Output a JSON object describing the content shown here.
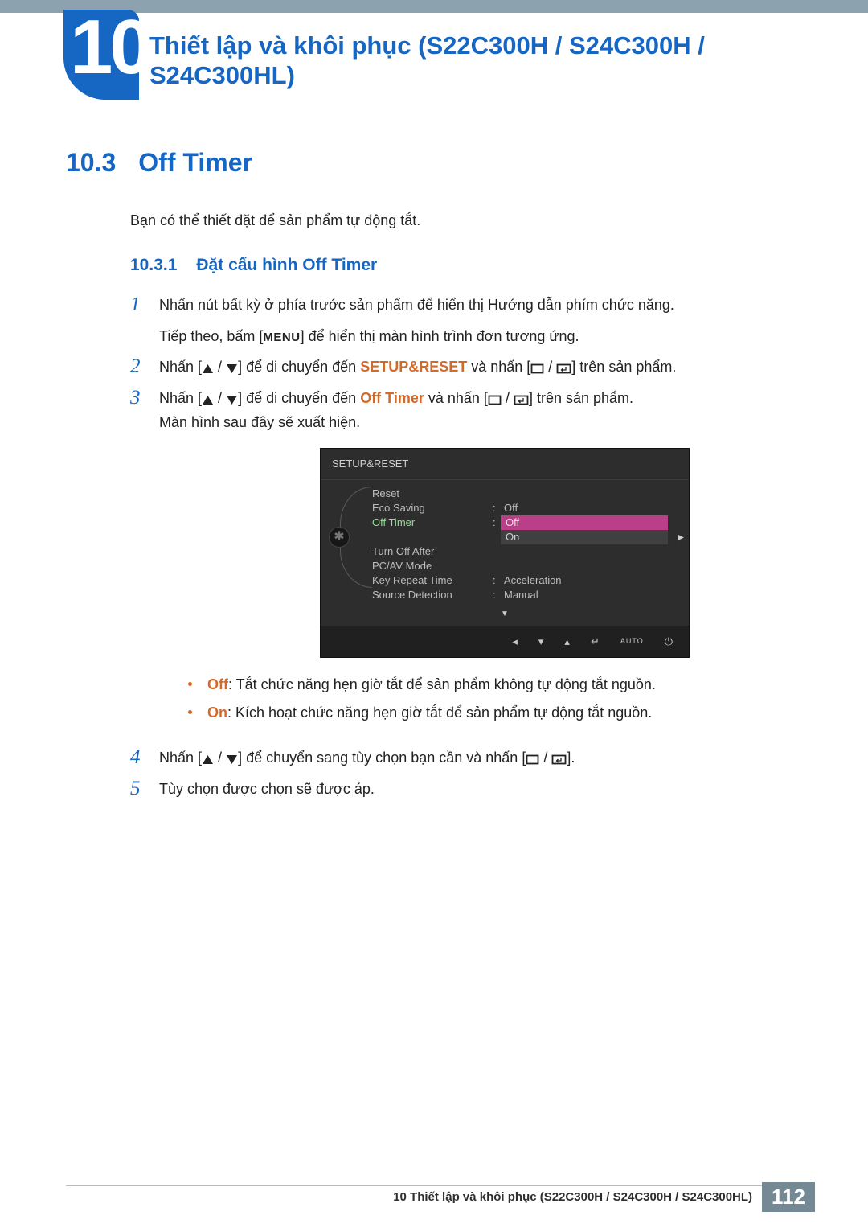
{
  "chapter": {
    "num": "10",
    "title": "Thiết lập và khôi phục (S22C300H / S24C300H / S24C300HL)"
  },
  "section": {
    "num": "10.3",
    "title": "Off Timer",
    "intro": "Bạn có thể thiết đặt để sản phẩm tự động tắt."
  },
  "subsection": {
    "num": "10.3.1",
    "title": "Đặt cấu hình Off Timer"
  },
  "steps": {
    "s1": {
      "num": "1",
      "a": "Nhấn nút bất kỳ ở phía trước sản phẩm để hiển thị Hướng dẫn phím chức năng.",
      "b_pre": "Tiếp theo, bấm [",
      "menu": "MENU",
      "b_post": "] để hiển thị màn hình trình đơn tương ứng."
    },
    "s2": {
      "num": "2",
      "a_pre": "Nhấn [",
      "a_mid": "] để di chuyển đến ",
      "kw": "SETUP&RESET",
      "a_mid2": " và nhấn [",
      "a_post": "] trên sản phẩm."
    },
    "s3": {
      "num": "3",
      "a_pre": "Nhấn [",
      "a_mid": "] để di chuyển đến ",
      "kw": "Off Timer",
      "a_mid2": " và nhấn [",
      "a_post": "] trên sản phẩm.",
      "b": "Màn hình sau đây sẽ xuất hiện.",
      "bullet_off_label": "Off",
      "bullet_off_text": ": Tắt chức năng hẹn giờ tắt để sản phẩm không tự động tắt nguồn.",
      "bullet_on_label": "On",
      "bullet_on_text": ": Kích hoạt chức năng hẹn giờ tắt để sản phẩm tự động tắt nguồn."
    },
    "s4": {
      "num": "4",
      "a_pre": "Nhấn [",
      "a_mid": "] để chuyển sang tùy chọn bạn cần và nhấn [",
      "a_post": "]."
    },
    "s5": {
      "num": "5",
      "a": "Tùy chọn được chọn sẽ được áp."
    }
  },
  "osd": {
    "title": "SETUP&RESET",
    "rows": {
      "reset": "Reset",
      "eco": "Eco Saving",
      "eco_val": "Off",
      "off_timer": "Off Timer",
      "off_timer_val": "Off",
      "off_timer_sub": "On",
      "turn_off_after": "Turn Off After",
      "pcav": "PC/AV Mode",
      "krt": "Key Repeat Time",
      "krt_val": "Acceleration",
      "src": "Source Detection",
      "src_val": "Manual"
    },
    "foot_auto": "AUTO"
  },
  "footer": {
    "text": "10 Thiết lập và khôi phục (S22C300H / S24C300H / S24C300HL)",
    "page": "112"
  }
}
